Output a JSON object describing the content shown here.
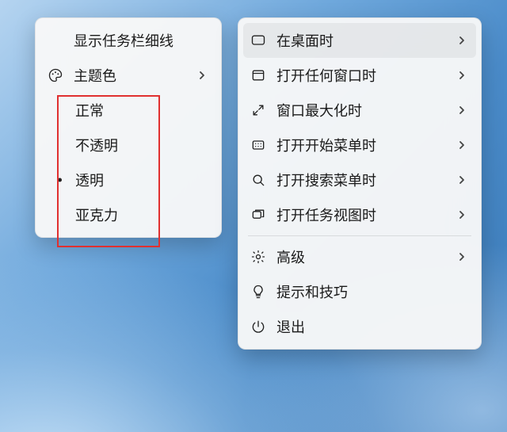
{
  "left_menu": {
    "show_thin_taskbar": "显示任务栏细线",
    "theme_color": "主题色",
    "submenu": {
      "normal": "正常",
      "opaque": "不透明",
      "transparent": "透明",
      "acrylic": "亚克力",
      "selected": "transparent"
    }
  },
  "right_menu": {
    "on_desktop": "在桌面时",
    "any_window_open": "打开任何窗口时",
    "window_maximized": "窗口最大化时",
    "start_menu_open": "打开开始菜单时",
    "search_menu_open": "打开搜索菜单时",
    "task_view_open": "打开任务视图时",
    "advanced": "高级",
    "tips_tricks": "提示和技巧",
    "exit": "退出",
    "selected": "on_desktop"
  }
}
